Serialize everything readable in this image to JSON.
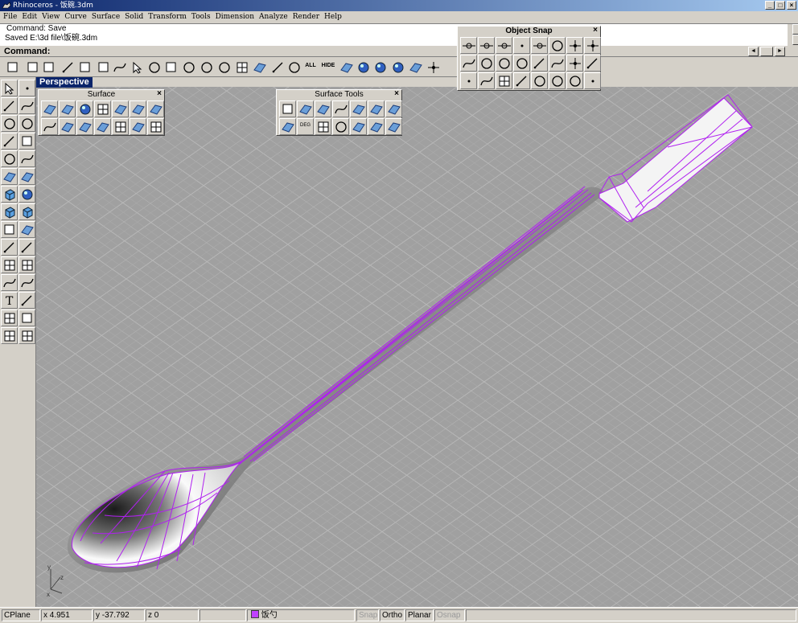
{
  "window": {
    "title": "Rhinoceros - 饭碗.3dm",
    "controls": [
      "_",
      "□",
      "×"
    ]
  },
  "menu": [
    "File",
    "Edit",
    "View",
    "Curve",
    "Surface",
    "Solid",
    "Transform",
    "Tools",
    "Dimension",
    "Analyze",
    "Render",
    "Help"
  ],
  "history": [
    "Command: Save",
    "Saved E:\\3d file\\饭碗.3dm"
  ],
  "command": {
    "label": "Command:",
    "value": ""
  },
  "toolbar": {
    "icons": [
      "new-icon",
      "open-icon",
      "save-icon",
      "cut-icon",
      "copy-icon",
      "paste-icon",
      "undo-icon",
      "pan-icon",
      "rotate-view-icon",
      "zoom-window-icon",
      "zoom-dynamic-icon",
      "zoom-extents-icon",
      "zoom-selected-icon",
      "four-viewports-icon",
      "car-icon",
      "pointer-icon",
      "show-points-icon",
      "show-all-icon",
      "hide-icon",
      "layer-icon",
      "color-wheel-icon",
      "shaded-sphere-icon",
      "render-sphere-icon",
      "light-icon",
      "gear-icon"
    ],
    "all": "ALL",
    "hide": "HIDE"
  },
  "viewport": {
    "label": "Perspective",
    "axes": {
      "x": "x",
      "y": "y",
      "z": "z"
    }
  },
  "palettes": {
    "surface": "Surface",
    "surface_tools": "Surface Tools",
    "object_snap": "Object Snap",
    "deg": "DEG"
  },
  "status": {
    "cplane": "CPlane",
    "x": "x 4.951",
    "y": "y -37.792",
    "z": "z 0",
    "layer": "饭勺",
    "snap": "Snap",
    "ortho": "Ortho",
    "planar": "Planar",
    "osnap": "Osnap"
  },
  "colors": {
    "layer": "#c040ff",
    "wire": "#b020f0",
    "viewport": "#a0a0a0",
    "title": "#0a246a"
  }
}
